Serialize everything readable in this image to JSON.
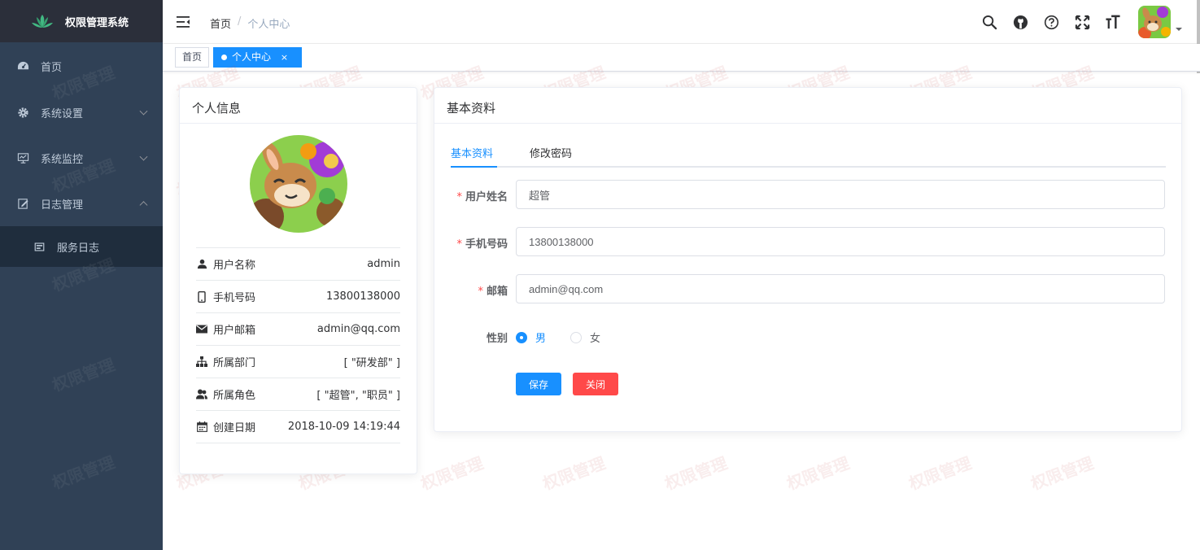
{
  "sidebar": {
    "logo_title": "权限管理系统",
    "items": [
      {
        "label": "首页"
      },
      {
        "label": "系统设置"
      },
      {
        "label": "系统监控"
      },
      {
        "label": "日志管理"
      }
    ],
    "sub_items": [
      {
        "label": "服务日志"
      }
    ]
  },
  "navbar": {
    "breadcrumb_home": "首页",
    "breadcrumb_sep": "/",
    "breadcrumb_current": "个人中心"
  },
  "tags": {
    "home": "首页",
    "active": "个人中心",
    "close": "×"
  },
  "watermark": "权限管理",
  "profile": {
    "title": "个人信息",
    "rows": [
      {
        "label": "用户名称",
        "value": "admin",
        "icon": "user-icon"
      },
      {
        "label": "手机号码",
        "value": "13800138000",
        "icon": "phone-icon"
      },
      {
        "label": "用户邮箱",
        "value": "admin@qq.com",
        "icon": "email-icon"
      },
      {
        "label": "所属部门",
        "value": "[ \"研发部\" ]",
        "icon": "tree-icon"
      },
      {
        "label": "所属角色",
        "value": "[ \"超管\", \"职员\" ]",
        "icon": "peoples-icon"
      },
      {
        "label": "创建日期",
        "value": "2018-10-09 14:19:44",
        "icon": "date-icon"
      }
    ]
  },
  "basic": {
    "title": "基本资料",
    "tabs": [
      "基本资料",
      "修改密码"
    ],
    "fields": {
      "nickname_label": "用户姓名",
      "nickname_value": "超管",
      "phone_label": "手机号码",
      "phone_value": "13800138000",
      "email_label": "邮箱",
      "email_value": "admin@qq.com",
      "gender_label": "性别",
      "gender_male": "男",
      "gender_female": "女",
      "gender_selected": "男"
    },
    "required_mark": "*",
    "save_label": "保存",
    "close_label": "关闭"
  },
  "colors": {
    "primary": "#1890ff",
    "danger": "#ff4949",
    "sidebar_bg": "#304156",
    "sidebar_logo_bg": "#2b2f3a",
    "submenu_bg": "#1f2d3d"
  }
}
